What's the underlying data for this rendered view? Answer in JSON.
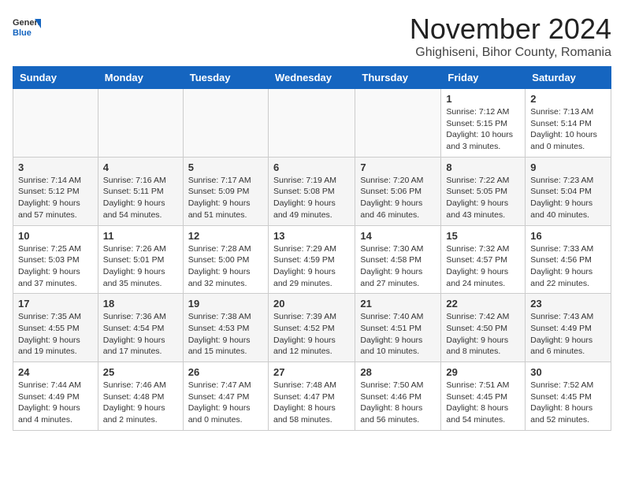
{
  "header": {
    "logo_general": "General",
    "logo_blue": "Blue",
    "month_title": "November 2024",
    "location": "Ghighiseni, Bihor County, Romania"
  },
  "weekdays": [
    "Sunday",
    "Monday",
    "Tuesday",
    "Wednesday",
    "Thursday",
    "Friday",
    "Saturday"
  ],
  "weeks": [
    [
      {
        "day": "",
        "info": ""
      },
      {
        "day": "",
        "info": ""
      },
      {
        "day": "",
        "info": ""
      },
      {
        "day": "",
        "info": ""
      },
      {
        "day": "",
        "info": ""
      },
      {
        "day": "1",
        "info": "Sunrise: 7:12 AM\nSunset: 5:15 PM\nDaylight: 10 hours and 3 minutes."
      },
      {
        "day": "2",
        "info": "Sunrise: 7:13 AM\nSunset: 5:14 PM\nDaylight: 10 hours and 0 minutes."
      }
    ],
    [
      {
        "day": "3",
        "info": "Sunrise: 7:14 AM\nSunset: 5:12 PM\nDaylight: 9 hours and 57 minutes."
      },
      {
        "day": "4",
        "info": "Sunrise: 7:16 AM\nSunset: 5:11 PM\nDaylight: 9 hours and 54 minutes."
      },
      {
        "day": "5",
        "info": "Sunrise: 7:17 AM\nSunset: 5:09 PM\nDaylight: 9 hours and 51 minutes."
      },
      {
        "day": "6",
        "info": "Sunrise: 7:19 AM\nSunset: 5:08 PM\nDaylight: 9 hours and 49 minutes."
      },
      {
        "day": "7",
        "info": "Sunrise: 7:20 AM\nSunset: 5:06 PM\nDaylight: 9 hours and 46 minutes."
      },
      {
        "day": "8",
        "info": "Sunrise: 7:22 AM\nSunset: 5:05 PM\nDaylight: 9 hours and 43 minutes."
      },
      {
        "day": "9",
        "info": "Sunrise: 7:23 AM\nSunset: 5:04 PM\nDaylight: 9 hours and 40 minutes."
      }
    ],
    [
      {
        "day": "10",
        "info": "Sunrise: 7:25 AM\nSunset: 5:03 PM\nDaylight: 9 hours and 37 minutes."
      },
      {
        "day": "11",
        "info": "Sunrise: 7:26 AM\nSunset: 5:01 PM\nDaylight: 9 hours and 35 minutes."
      },
      {
        "day": "12",
        "info": "Sunrise: 7:28 AM\nSunset: 5:00 PM\nDaylight: 9 hours and 32 minutes."
      },
      {
        "day": "13",
        "info": "Sunrise: 7:29 AM\nSunset: 4:59 PM\nDaylight: 9 hours and 29 minutes."
      },
      {
        "day": "14",
        "info": "Sunrise: 7:30 AM\nSunset: 4:58 PM\nDaylight: 9 hours and 27 minutes."
      },
      {
        "day": "15",
        "info": "Sunrise: 7:32 AM\nSunset: 4:57 PM\nDaylight: 9 hours and 24 minutes."
      },
      {
        "day": "16",
        "info": "Sunrise: 7:33 AM\nSunset: 4:56 PM\nDaylight: 9 hours and 22 minutes."
      }
    ],
    [
      {
        "day": "17",
        "info": "Sunrise: 7:35 AM\nSunset: 4:55 PM\nDaylight: 9 hours and 19 minutes."
      },
      {
        "day": "18",
        "info": "Sunrise: 7:36 AM\nSunset: 4:54 PM\nDaylight: 9 hours and 17 minutes."
      },
      {
        "day": "19",
        "info": "Sunrise: 7:38 AM\nSunset: 4:53 PM\nDaylight: 9 hours and 15 minutes."
      },
      {
        "day": "20",
        "info": "Sunrise: 7:39 AM\nSunset: 4:52 PM\nDaylight: 9 hours and 12 minutes."
      },
      {
        "day": "21",
        "info": "Sunrise: 7:40 AM\nSunset: 4:51 PM\nDaylight: 9 hours and 10 minutes."
      },
      {
        "day": "22",
        "info": "Sunrise: 7:42 AM\nSunset: 4:50 PM\nDaylight: 9 hours and 8 minutes."
      },
      {
        "day": "23",
        "info": "Sunrise: 7:43 AM\nSunset: 4:49 PM\nDaylight: 9 hours and 6 minutes."
      }
    ],
    [
      {
        "day": "24",
        "info": "Sunrise: 7:44 AM\nSunset: 4:49 PM\nDaylight: 9 hours and 4 minutes."
      },
      {
        "day": "25",
        "info": "Sunrise: 7:46 AM\nSunset: 4:48 PM\nDaylight: 9 hours and 2 minutes."
      },
      {
        "day": "26",
        "info": "Sunrise: 7:47 AM\nSunset: 4:47 PM\nDaylight: 9 hours and 0 minutes."
      },
      {
        "day": "27",
        "info": "Sunrise: 7:48 AM\nSunset: 4:47 PM\nDaylight: 8 hours and 58 minutes."
      },
      {
        "day": "28",
        "info": "Sunrise: 7:50 AM\nSunset: 4:46 PM\nDaylight: 8 hours and 56 minutes."
      },
      {
        "day": "29",
        "info": "Sunrise: 7:51 AM\nSunset: 4:45 PM\nDaylight: 8 hours and 54 minutes."
      },
      {
        "day": "30",
        "info": "Sunrise: 7:52 AM\nSunset: 4:45 PM\nDaylight: 8 hours and 52 minutes."
      }
    ]
  ]
}
